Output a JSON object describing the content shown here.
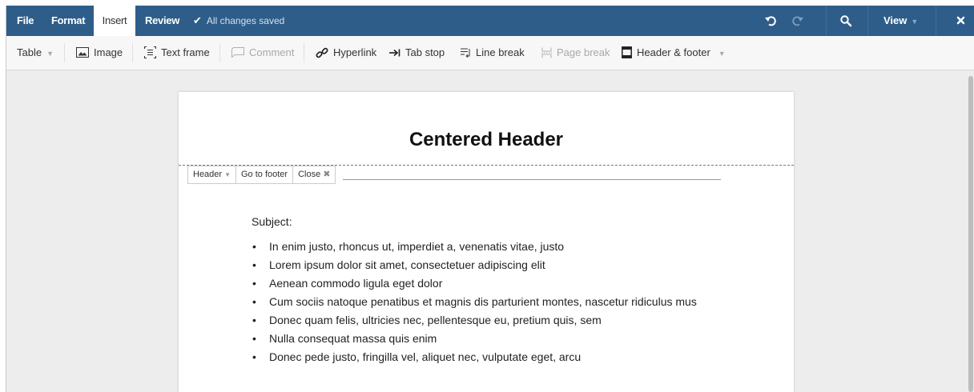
{
  "menubar": {
    "file": "File",
    "format": "Format",
    "insert": "Insert",
    "review": "Review",
    "saved_status": "All changes saved",
    "view": "View"
  },
  "toolbar": {
    "table": "Table",
    "image": "Image",
    "text_frame": "Text frame",
    "comment": "Comment",
    "hyperlink": "Hyperlink",
    "tab_stop": "Tab stop",
    "line_break": "Line break",
    "page_break": "Page break",
    "header_footer": "Header & footer"
  },
  "document": {
    "header_text": "Centered Header",
    "hf_controls": {
      "header": "Header",
      "go_to_footer": "Go to footer",
      "close": "Close"
    },
    "subject": "Subject:",
    "bullets": [
      "In enim justo, rhoncus ut, imperdiet a, venenatis vitae, justo",
      "Lorem ipsum dolor sit amet, consectetuer adipiscing elit",
      "Aenean commodo ligula eget dolor",
      "Cum sociis natoque penatibus et magnis dis parturient montes, nascetur ridiculus mus",
      "Donec quam felis, ultricies nec, pellentesque eu, pretium quis, sem",
      "Nulla consequat massa quis enim",
      "Donec pede justo, fringilla vel, aliquet nec, vulputate eget, arcu"
    ]
  },
  "colors": {
    "menubar_bg": "#2e5d8a",
    "toolbar_bg": "#f7f7f7",
    "canvas_bg": "#ededed"
  },
  "icons": {
    "undo": "undo-icon",
    "redo": "redo-icon",
    "search": "search-icon",
    "close": "close-icon",
    "image": "image-icon",
    "text_frame": "text-frame-icon",
    "comment": "comment-icon",
    "hyperlink": "link-icon",
    "tab_stop": "tab-stop-icon",
    "line_break": "line-break-icon",
    "page_break": "page-break-icon",
    "header_footer": "header-footer-icon"
  }
}
